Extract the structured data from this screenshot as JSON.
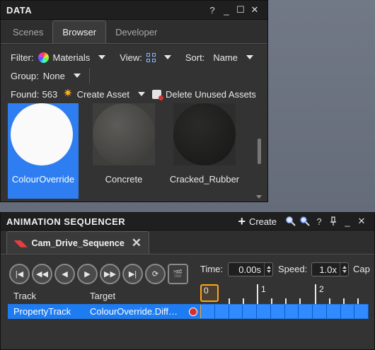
{
  "data_panel": {
    "title": "DATA",
    "buttons": {
      "help": "?",
      "minimize": "_",
      "maximize": "☐",
      "close": "✕"
    },
    "tabs": [
      "Scenes",
      "Browser",
      "Developer"
    ],
    "active_tab": "Browser",
    "filter": {
      "label": "Filter:",
      "value": "Materials"
    },
    "view": {
      "label": "View:"
    },
    "sort": {
      "label": "Sort:",
      "value": "Name"
    },
    "group": {
      "label": "Group:",
      "value": "None"
    },
    "found": {
      "label": "Found:",
      "count": "563"
    },
    "create_asset": "Create Asset",
    "delete_unused": "Delete Unused Assets",
    "assets": [
      {
        "name": "ColourOverride",
        "selected": true
      },
      {
        "name": "Concrete",
        "selected": false
      },
      {
        "name": "Cracked_Rubber",
        "selected": false
      }
    ]
  },
  "sequencer": {
    "title": "ANIMATION SEQUENCER",
    "create_label": "Create",
    "buttons": {
      "help": "?",
      "pin": "⊥",
      "minimize": "_",
      "close": "✕"
    },
    "tab_label": "Cam_Drive_Sequence",
    "time": {
      "label": "Time:",
      "value": "0.00s"
    },
    "speed": {
      "label": "Speed:",
      "value": "1.0x"
    },
    "cap_label": "Cap",
    "columns": {
      "track": "Track",
      "target": "Target"
    },
    "ruler_labels": [
      "0",
      "1",
      "2"
    ],
    "track_row": {
      "track": "PropertyTrack",
      "target": "ColourOverride.Diff…"
    },
    "colors": {
      "accent": "#1e7cf2",
      "playhead": "#ffa51c"
    }
  }
}
